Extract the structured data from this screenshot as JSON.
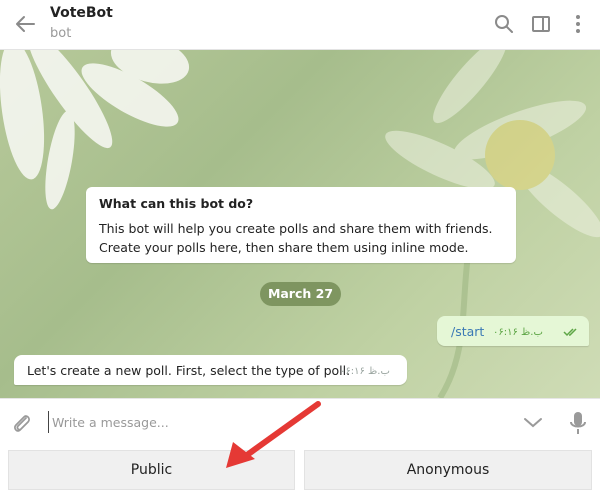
{
  "header": {
    "title": "VoteBot",
    "subtitle": "bot",
    "icons": [
      "back-arrow-icon",
      "search-icon",
      "sidebar-panel-icon",
      "more-vertical-icon"
    ]
  },
  "chat": {
    "info_card": {
      "title": "What can this bot do?",
      "line1": "This bot will help you create polls and share them with friends.",
      "line2": "Create your polls here, then share them using inline mode."
    },
    "date_separator": "March 27",
    "outgoing": {
      "text": "/start",
      "time": "ب.ظ ۰۶:۱۶"
    },
    "incoming": {
      "text": "Let's create a new poll. First, select the type of poll.",
      "time": "ب.ظ ۰۶:۱۶"
    }
  },
  "composer": {
    "placeholder": "Write a message...",
    "value": ""
  },
  "keyboard": {
    "buttons": [
      "Public",
      "Anonymous"
    ]
  },
  "colors": {
    "annotation_arrow": "#e53935",
    "outgoing_bubble": "#e5f7d6",
    "date_pill": "#748c56"
  }
}
